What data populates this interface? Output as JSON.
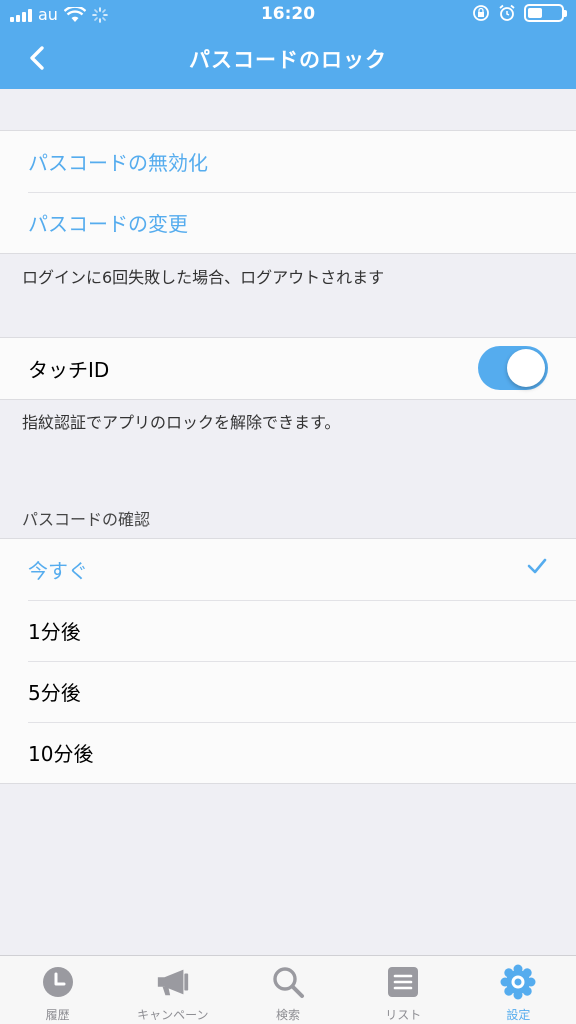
{
  "status_bar": {
    "carrier": "au",
    "time": "16:20"
  },
  "nav": {
    "title": "パスコードのロック"
  },
  "passcode_actions": {
    "items": [
      {
        "label": "パスコードの無効化"
      },
      {
        "label": "パスコードの変更"
      }
    ],
    "note": "ログインに6回失敗した場合、ログアウトされます"
  },
  "touch_id": {
    "label": "タッチID",
    "enabled": true,
    "note": "指紋認証でアプリのロックを解除できます。"
  },
  "confirm": {
    "header": "パスコードの確認",
    "options": [
      {
        "label": "今すぐ",
        "selected": true
      },
      {
        "label": "1分後",
        "selected": false
      },
      {
        "label": "5分後",
        "selected": false
      },
      {
        "label": "10分後",
        "selected": false
      }
    ]
  },
  "tabbar": {
    "tabs": [
      {
        "label": "履歴",
        "icon": "clock-icon"
      },
      {
        "label": "キャンペーン",
        "icon": "megaphone-icon"
      },
      {
        "label": "検索",
        "icon": "search-icon"
      },
      {
        "label": "リスト",
        "icon": "list-icon"
      },
      {
        "label": "設定",
        "icon": "gear-icon",
        "active": true
      }
    ]
  },
  "colors": {
    "accent": "#55acee",
    "background": "#efeff4",
    "tab_inactive": "#8e8e93"
  }
}
